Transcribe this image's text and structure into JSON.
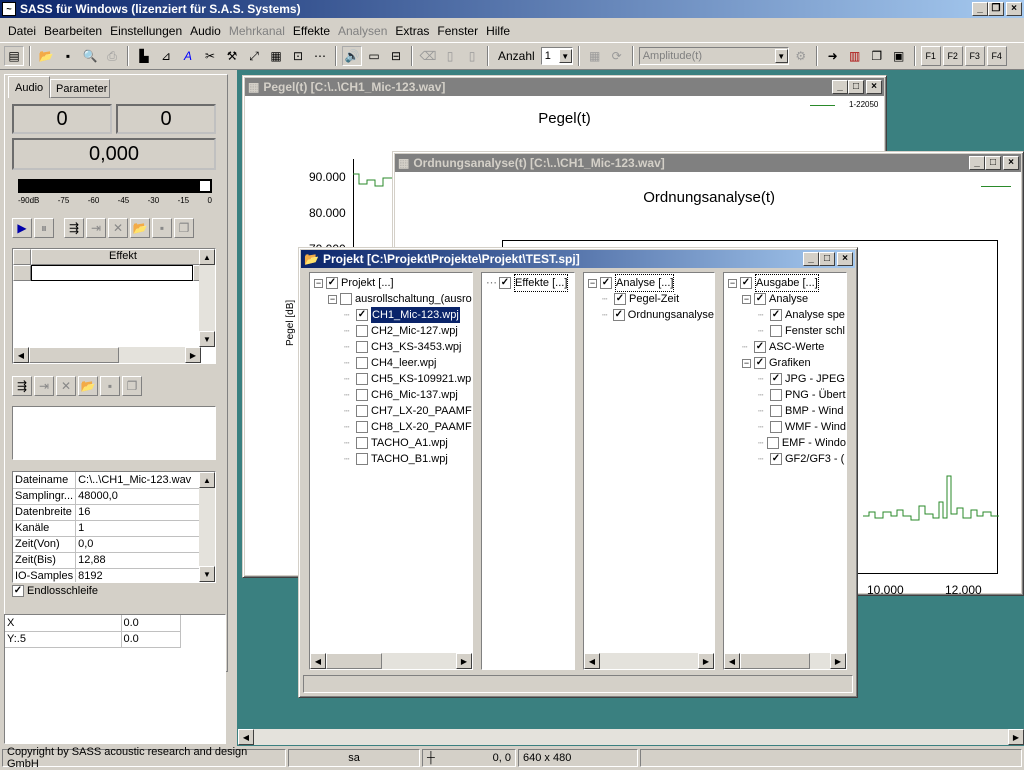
{
  "app": {
    "title": "SASS für Windows (lizenziert für S.A.S. Systems)"
  },
  "menu": [
    "Datei",
    "Bearbeiten",
    "Einstellungen",
    "Audio",
    "Mehrkanal",
    "Effekte",
    "Analysen",
    "Extras",
    "Fenster",
    "Hilfe"
  ],
  "menu_disabled": [
    "Mehrkanal",
    "Analysen"
  ],
  "toolbar": {
    "anzahl_label": "Anzahl",
    "anzahl_value": "1",
    "dropdown_value": "Amplitude(t)",
    "fkeys": [
      "F1",
      "F2",
      "F3",
      "F4"
    ]
  },
  "left": {
    "tabs": [
      "Audio",
      "Parameter"
    ],
    "val1": "0",
    "val2": "0",
    "val3": "0,000",
    "meter_labels": [
      "-90dB",
      "-75",
      "-60",
      "-45",
      "-30",
      "-15",
      "0"
    ],
    "effekt_header": "Effekt",
    "props": [
      {
        "k": "Dateiname",
        "v": "C:\\..\\CH1_Mic-123.wav"
      },
      {
        "k": "Samplingr...",
        "v": "48000,0"
      },
      {
        "k": "Datenbreite",
        "v": "16"
      },
      {
        "k": "Kanäle",
        "v": "1"
      },
      {
        "k": "Zeit(Von)",
        "v": "0,0"
      },
      {
        "k": "Zeit(Bis)",
        "v": "12,88"
      },
      {
        "k": "IO-Samples",
        "v": "8192"
      }
    ],
    "endless_label": "Endlosschleife",
    "xy": [
      {
        "k": "X",
        "v": "0.0"
      },
      {
        "k": "Y:.5",
        "v": "0.0"
      }
    ]
  },
  "pegel": {
    "title": "Pegel(t) [C:\\..\\CH1_Mic-123.wav]",
    "chart_title": "Pegel(t)",
    "legend": "1-22050",
    "yticks": [
      "90.000",
      "80.000",
      "70.000"
    ],
    "ylabel": "Pegel [dB]"
  },
  "ordnung": {
    "title": "Ordnungsanalyse(t) [C:\\..\\CH1_Mic-123.wav]",
    "chart_title": "Ordnungsanalyse(t)",
    "xticks": [
      "10.000",
      "12.000"
    ]
  },
  "projekt": {
    "title": "Projekt [C:\\Projekt\\Projekte\\Projekt\\TEST.spj]",
    "col1": {
      "root": "Projekt [...]",
      "sub": "ausrollschaltung_(ausro",
      "items": [
        {
          "label": "CH1_Mic-123.wpj",
          "checked": true,
          "selected": true
        },
        {
          "label": "CH2_Mic-127.wpj",
          "checked": false
        },
        {
          "label": "CH3_KS-3453.wpj",
          "checked": false
        },
        {
          "label": "CH4_leer.wpj",
          "checked": false
        },
        {
          "label": "CH5_KS-109921.wp",
          "checked": false
        },
        {
          "label": "CH6_Mic-137.wpj",
          "checked": false
        },
        {
          "label": "CH7_LX-20_PAAMF",
          "checked": false
        },
        {
          "label": "CH8_LX-20_PAAMF",
          "checked": false
        },
        {
          "label": "TACHO_A1.wpj",
          "checked": false
        },
        {
          "label": "TACHO_B1.wpj",
          "checked": false
        }
      ]
    },
    "col2": {
      "root": "Effekte [...]"
    },
    "col3": {
      "root": "Analyse [...]",
      "items": [
        "Pegel-Zeit",
        "Ordnungsanalyse"
      ]
    },
    "col4": {
      "root": "Ausgabe [...]",
      "analyse": "Analyse",
      "analyse_items": [
        {
          "label": "Analyse spe",
          "checked": true
        },
        {
          "label": "Fenster schl",
          "checked": false
        }
      ],
      "asc": "ASC-Werte",
      "grafiken": "Grafiken",
      "grafik_items": [
        {
          "label": "JPG - JPEG",
          "checked": true
        },
        {
          "label": "PNG - Übert",
          "checked": false
        },
        {
          "label": "BMP - Wind",
          "checked": false
        },
        {
          "label": "WMF - Wind",
          "checked": false
        },
        {
          "label": "EMF - Windo",
          "checked": false
        },
        {
          "label": "GF2/GF3 - (",
          "checked": true
        }
      ]
    }
  },
  "status": {
    "copyright": "Copyright by SASS acoustic research and design GmbH",
    "user": "sa",
    "coords": "0, 0",
    "size": "640 x 480"
  }
}
